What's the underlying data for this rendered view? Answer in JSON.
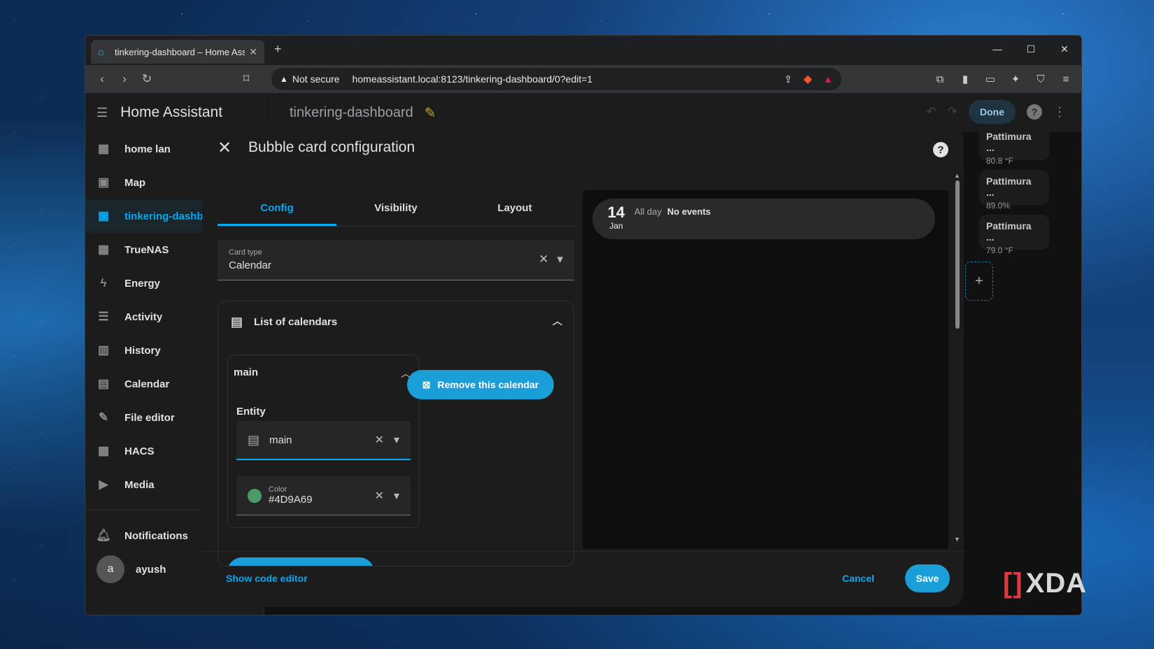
{
  "browser": {
    "tab_title": "tinkering-dashboard – Home Assistant",
    "security": "Not secure",
    "url": "homeassistant.local:8123/tinkering-dashboard/0?edit=1"
  },
  "sidebar": {
    "app_title": "Home Assistant",
    "items": [
      {
        "label": "home lan",
        "icon": "dashboard-icon"
      },
      {
        "label": "Map",
        "icon": "map-icon"
      },
      {
        "label": "tinkering-dashboard",
        "icon": "dashboard-icon",
        "active": true
      },
      {
        "label": "TrueNAS",
        "icon": "dashboard-icon"
      },
      {
        "label": "Energy",
        "icon": "lightning-icon"
      },
      {
        "label": "Activity",
        "icon": "list-icon"
      },
      {
        "label": "History",
        "icon": "chart-icon"
      },
      {
        "label": "Calendar",
        "icon": "calendar-icon"
      },
      {
        "label": "File editor",
        "icon": "wrench-icon"
      },
      {
        "label": "HACS",
        "icon": "hacs-icon"
      },
      {
        "label": "Media",
        "icon": "media-icon"
      }
    ],
    "notifications": "Notifications",
    "user": {
      "initial": "a",
      "name": "ayush"
    }
  },
  "header": {
    "dashboard_title": "tinkering-dashboard",
    "done_label": "Done"
  },
  "sensors": [
    {
      "name": "Pattimura ...",
      "value": "80.8 °F"
    },
    {
      "name": "Pattimura ...",
      "value": "89.0%"
    },
    {
      "name": "Pattimura ...",
      "value": "79.0 °F"
    }
  ],
  "dialog": {
    "title": "Bubble card configuration",
    "tabs": [
      "Config",
      "Visibility",
      "Layout"
    ],
    "card_type": {
      "label": "Card type",
      "value": "Calendar"
    },
    "section_title": "List of calendars",
    "calendar": {
      "name": "main",
      "entity_label": "Entity",
      "entity_value": "main",
      "color_label": "Color",
      "color_value": "#4D9A69"
    },
    "remove_label": "Remove this calendar",
    "preview": {
      "day": "14",
      "month": "Jan",
      "all_day": "All day",
      "event": "No events"
    },
    "code_editor": "Show code editor",
    "cancel": "Cancel",
    "save": "Save"
  },
  "watermark": "XDA",
  "colors": {
    "accent": "#03a9f4",
    "calendar_color": "#4D9A69"
  }
}
